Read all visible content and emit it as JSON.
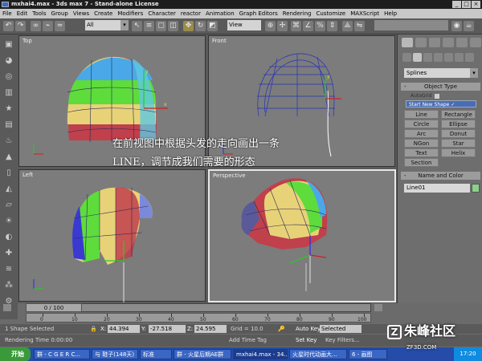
{
  "window": {
    "title": "mxhai4.max - 3ds max 7  - Stand-alone License"
  },
  "menu": [
    "File",
    "Edit",
    "Tools",
    "Group",
    "Views",
    "Create",
    "Modifiers",
    "Character",
    "reactor",
    "Animation",
    "Graph Editors",
    "Rendering",
    "Customize",
    "MAXScript",
    "Help"
  ],
  "toolbar": {
    "selection_filter": "All",
    "reference_coord": "View"
  },
  "viewports": {
    "top": "Top",
    "front": "Front",
    "left": "Left",
    "perspective": "Perspective"
  },
  "overlay": {
    "line1": "在前视图中根据头发的走向画出一条",
    "line2": "LINE，调节成我们需要的形态"
  },
  "command_panel": {
    "category": "Splines",
    "object_type_title": "Object Type",
    "autogrid": "AutoGrid",
    "start_new_shape": "Start New Shape",
    "buttons": [
      "Line",
      "Rectangle",
      "Circle",
      "Ellipse",
      "Arc",
      "Donut",
      "NGon",
      "Star",
      "Text",
      "Helix",
      "Section"
    ],
    "name_color_title": "Name and Color",
    "object_name": "Line01",
    "object_color": "#8cd08c"
  },
  "timeline": {
    "slider": "0 / 100",
    "ticks": [
      "0",
      "10",
      "20",
      "30",
      "40",
      "50",
      "60",
      "70",
      "80",
      "90",
      "100"
    ]
  },
  "status": {
    "selection": "1 Shape Selected",
    "x_label": "X:",
    "x": "44.394",
    "y_label": "Y:",
    "y": "-27.518",
    "z_label": "Z:",
    "z": "24.595",
    "grid": "Grid = 10.0",
    "auto_key": "Auto Key",
    "key_mode": "Selected",
    "set_key": "Set Key",
    "key_filters": "Key Filters...",
    "render_time": "Rendering Time  0:00:00",
    "add_time_tag": "Add Time Tag"
  },
  "taskbar": {
    "start": "开始",
    "tasks": [
      "群 - C G E R C...",
      "与 鞋子(148天)",
      "标准",
      "群 - 火星后期AE群",
      "mxhai4.max - 34...",
      "火星时代动画大...",
      "6 - 画图"
    ],
    "clock": "17:20"
  },
  "watermark": {
    "text": "朱峰社区",
    "sub": "ZF3D.COM"
  }
}
